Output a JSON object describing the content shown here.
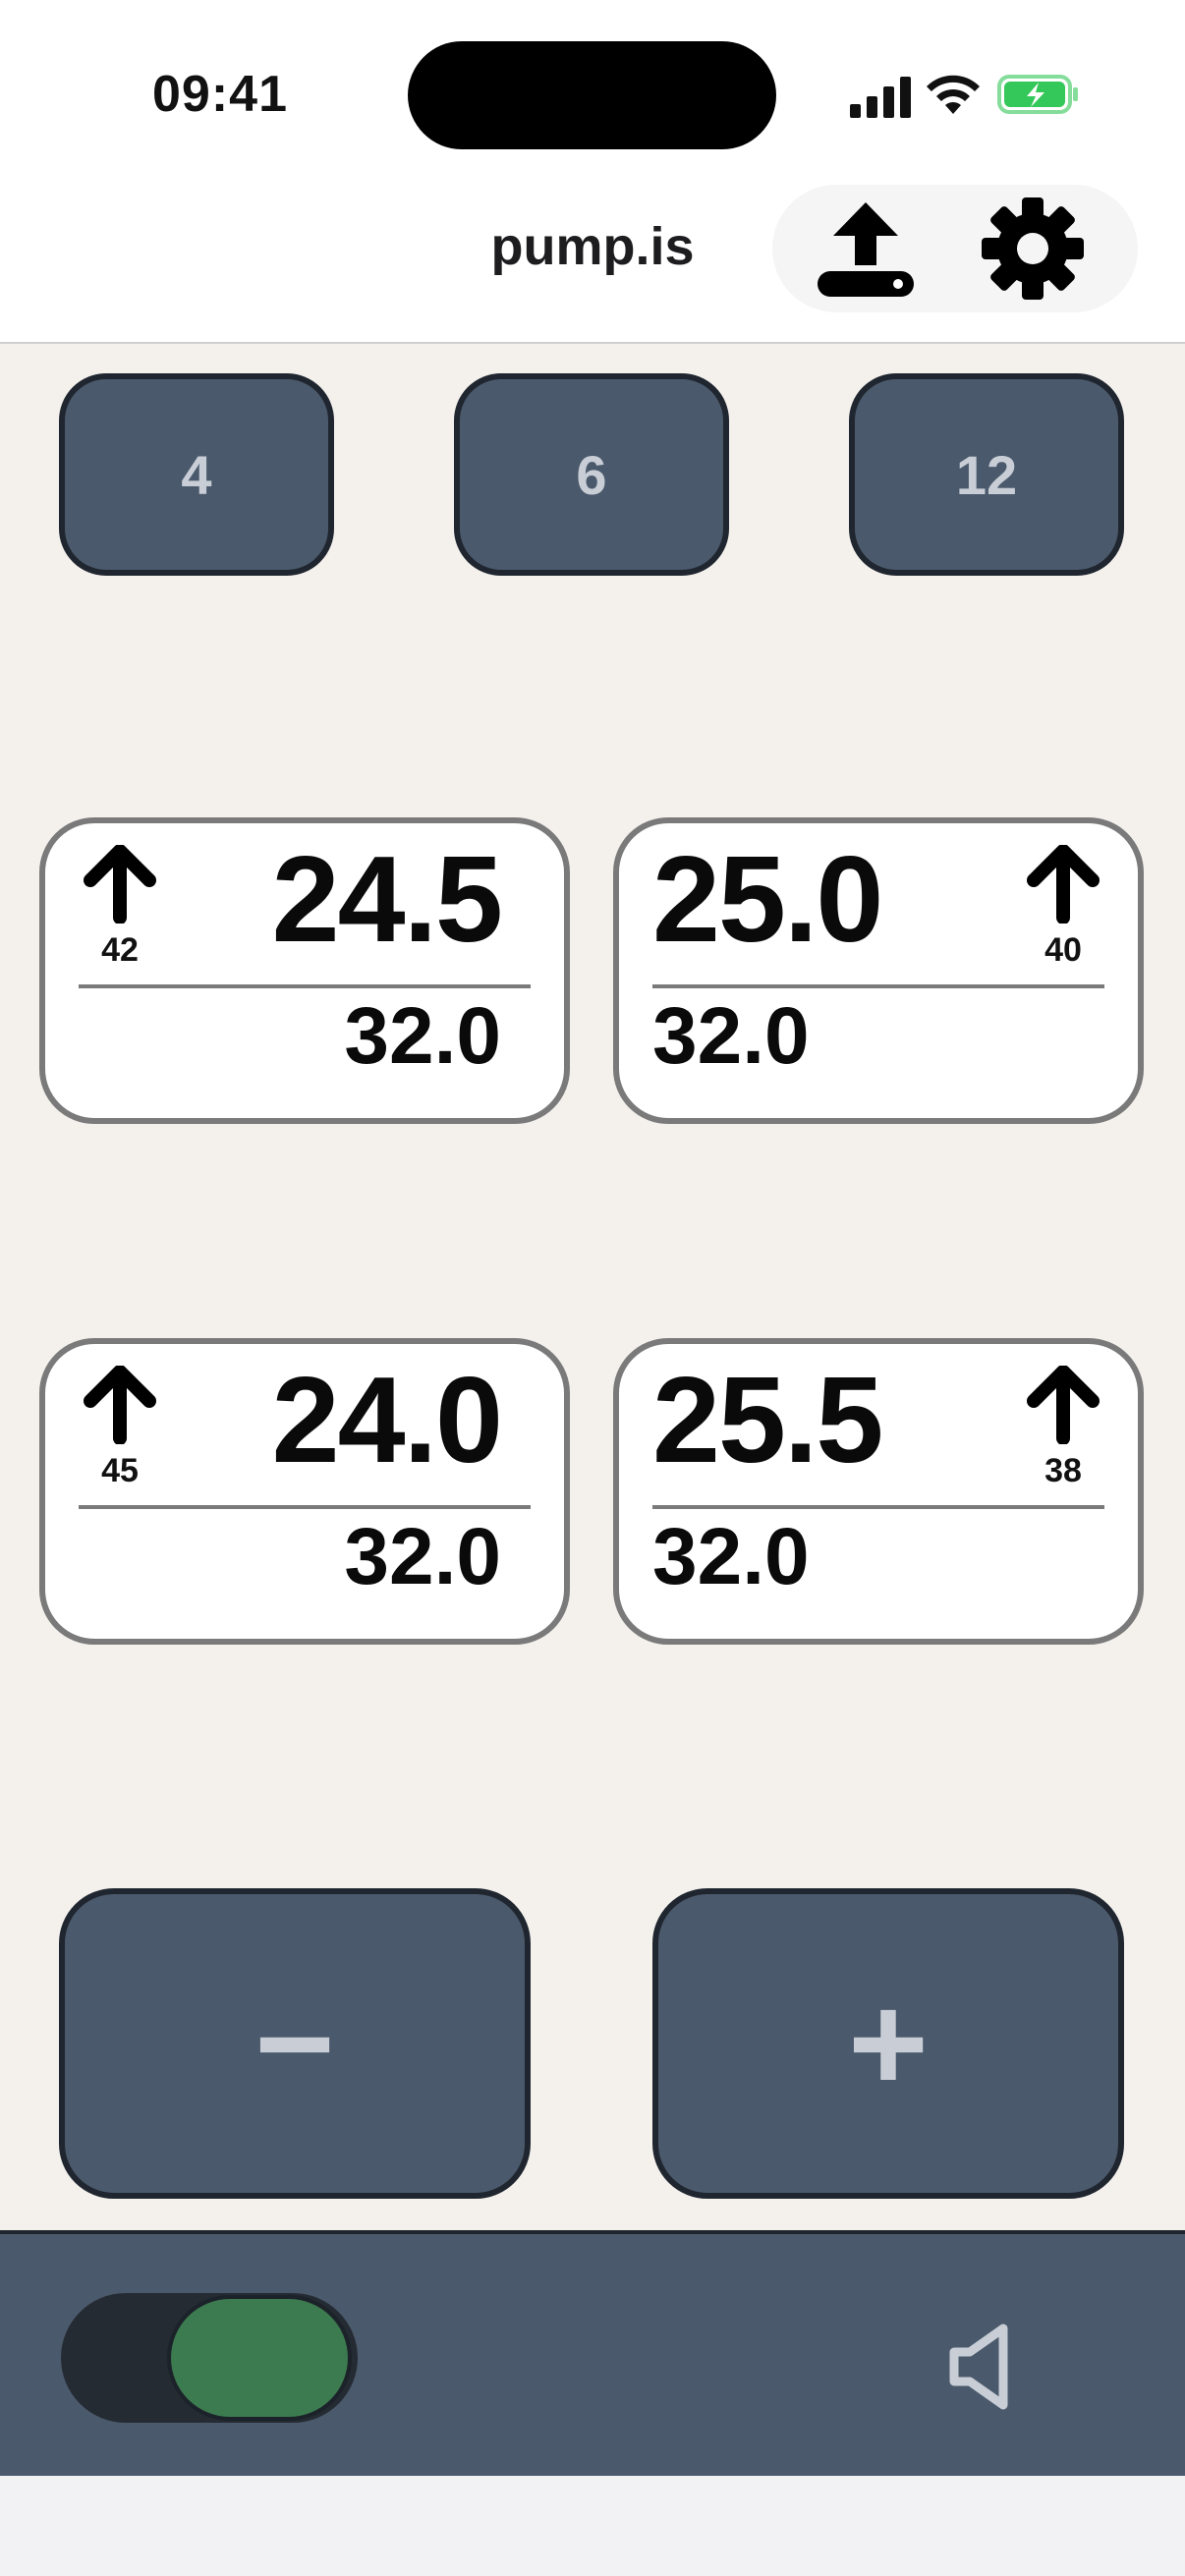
{
  "status_bar": {
    "time": "09:41",
    "icons": [
      "cellular-signal-icon",
      "wifi-icon",
      "battery-charging-icon"
    ],
    "battery_color": "#34c759"
  },
  "header": {
    "title": "pump.is",
    "actions": [
      "upload-icon",
      "gear-icon"
    ]
  },
  "presets": {
    "items": [
      {
        "label": "4"
      },
      {
        "label": "6"
      },
      {
        "label": "12"
      }
    ]
  },
  "cards": [
    {
      "main": "24.5",
      "secondary": "32.0",
      "arrow": "up",
      "arrow_value": "42"
    },
    {
      "main": "25.0",
      "secondary": "32.0",
      "arrow": "up",
      "arrow_value": "40"
    },
    {
      "main": "24.0",
      "secondary": "32.0",
      "arrow": "up",
      "arrow_value": "45"
    },
    {
      "main": "25.5",
      "secondary": "32.0",
      "arrow": "up",
      "arrow_value": "38"
    }
  ],
  "controls": {
    "minus_label": "−",
    "plus_label": "+"
  },
  "bottom_bar": {
    "toggle_on": true,
    "toggle_color": "#3c7a4f",
    "sound_icon": "speaker-muted-icon"
  },
  "colors": {
    "button_bg": "#4a596c",
    "button_border": "#20262f",
    "main_bg": "#f4f1ed"
  }
}
